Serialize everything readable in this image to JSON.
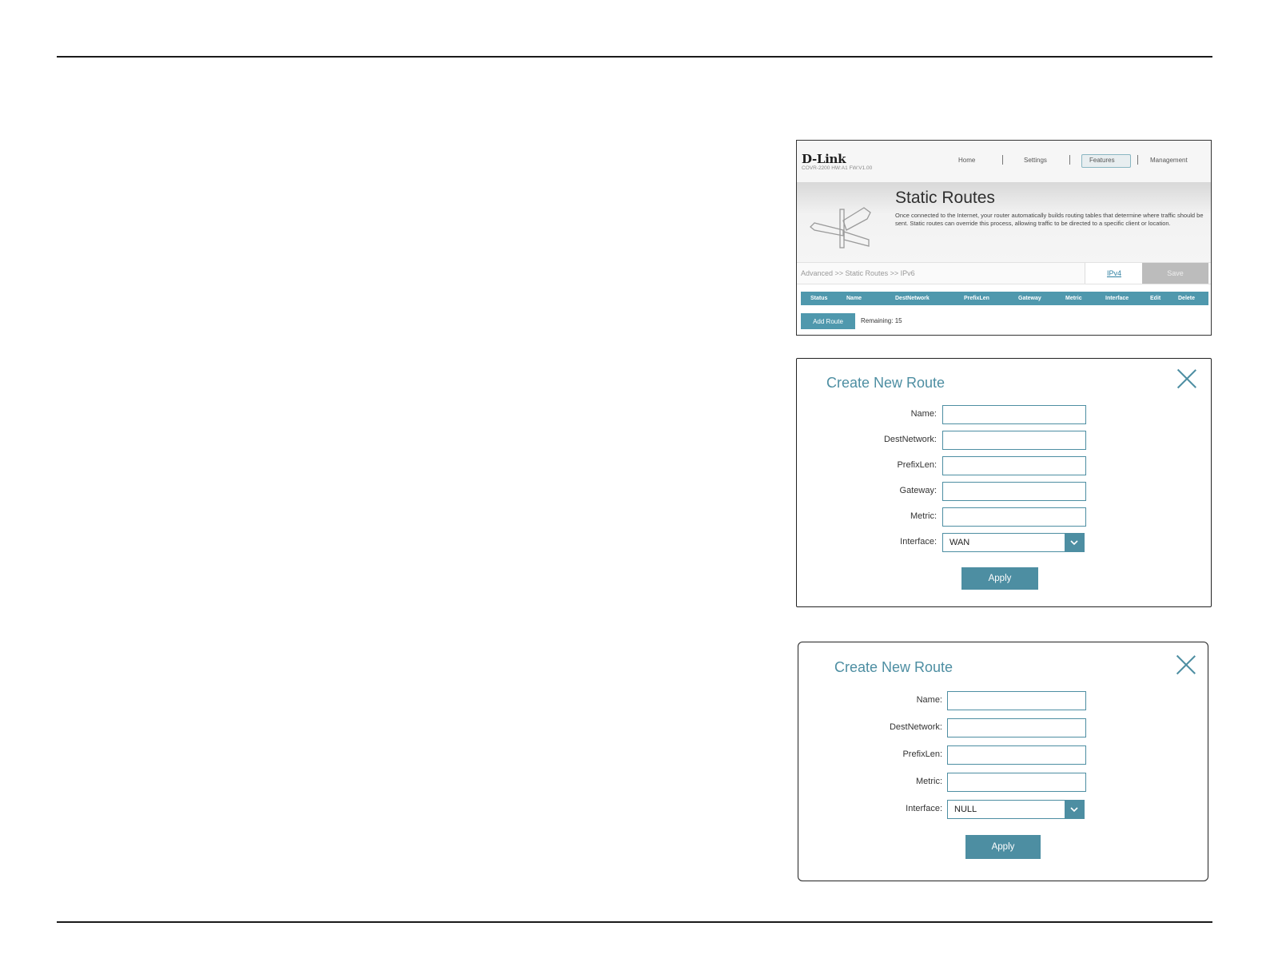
{
  "static_routes": {
    "logo": "D-Link",
    "model": "COVR-2200 HW:A1 FW:V1.00",
    "nav": [
      "Home",
      "Settings",
      "Features",
      "Management"
    ],
    "title": "Static Routes",
    "description": "Once connected to the Internet, your router automatically builds routing tables that determine where traffic should be sent. Static routes can override this process, allowing traffic to be directed to a specific client or location.",
    "breadcrumb": "Advanced >> Static Routes >> IPv6",
    "ipv4_link": "IPv4",
    "save_label": "Save",
    "columns": [
      "Status",
      "Name",
      "DestNetwork",
      "PrefixLen",
      "Gateway",
      "Metric",
      "Interface",
      "Edit",
      "Delete"
    ],
    "add_route_label": "Add Route",
    "remaining": "Remaining: 15"
  },
  "dialog_wan": {
    "title": "Create New Route",
    "labels": [
      "Name:",
      "DestNetwork:",
      "PrefixLen:",
      "Gateway:",
      "Metric:",
      "Interface:"
    ],
    "interface_value": "WAN",
    "apply_label": "Apply"
  },
  "dialog_null": {
    "title": "Create New Route",
    "labels": [
      "Name:",
      "DestNetwork:",
      "PrefixLen:",
      "Metric:",
      "Interface:"
    ],
    "interface_value": "NULL",
    "apply_label": "Apply"
  },
  "colors": {
    "accent": "#4d8ea2",
    "table_header": "#4f98ad",
    "save_disabled": "#bcbcbc"
  },
  "icons": [
    "signpost-icon",
    "close-icon",
    "chevron-down-icon"
  ]
}
